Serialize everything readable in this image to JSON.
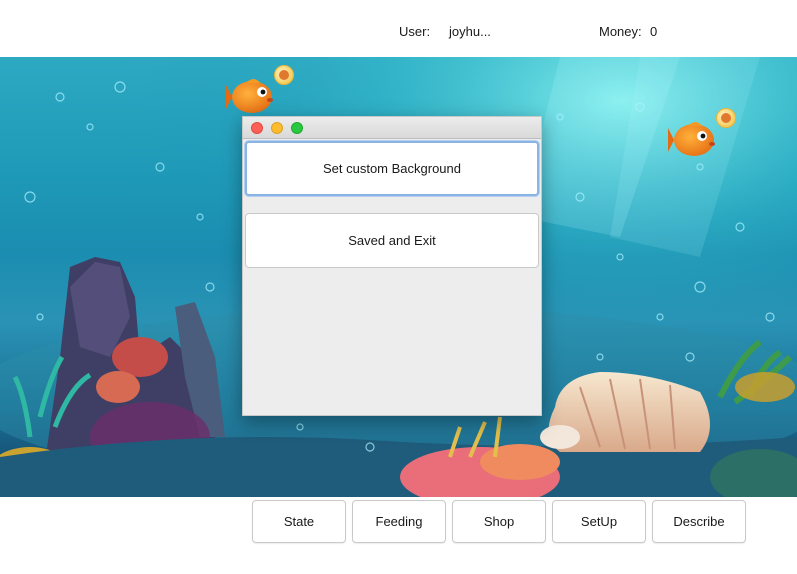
{
  "header": {
    "user_label": "User:",
    "user_value": "joyhu...",
    "money_label": "Money:",
    "money_value": "0"
  },
  "dialog": {
    "buttons": [
      "Set custom Background",
      "Saved and Exit"
    ]
  },
  "toolbar": {
    "buttons": [
      "State",
      "Feeding",
      "Shop",
      "SetUp",
      "Describe"
    ]
  },
  "scene": {
    "fish": [
      "fish-icon",
      "fish-icon"
    ],
    "coins": [
      "coin-icon",
      "coin-icon"
    ]
  }
}
